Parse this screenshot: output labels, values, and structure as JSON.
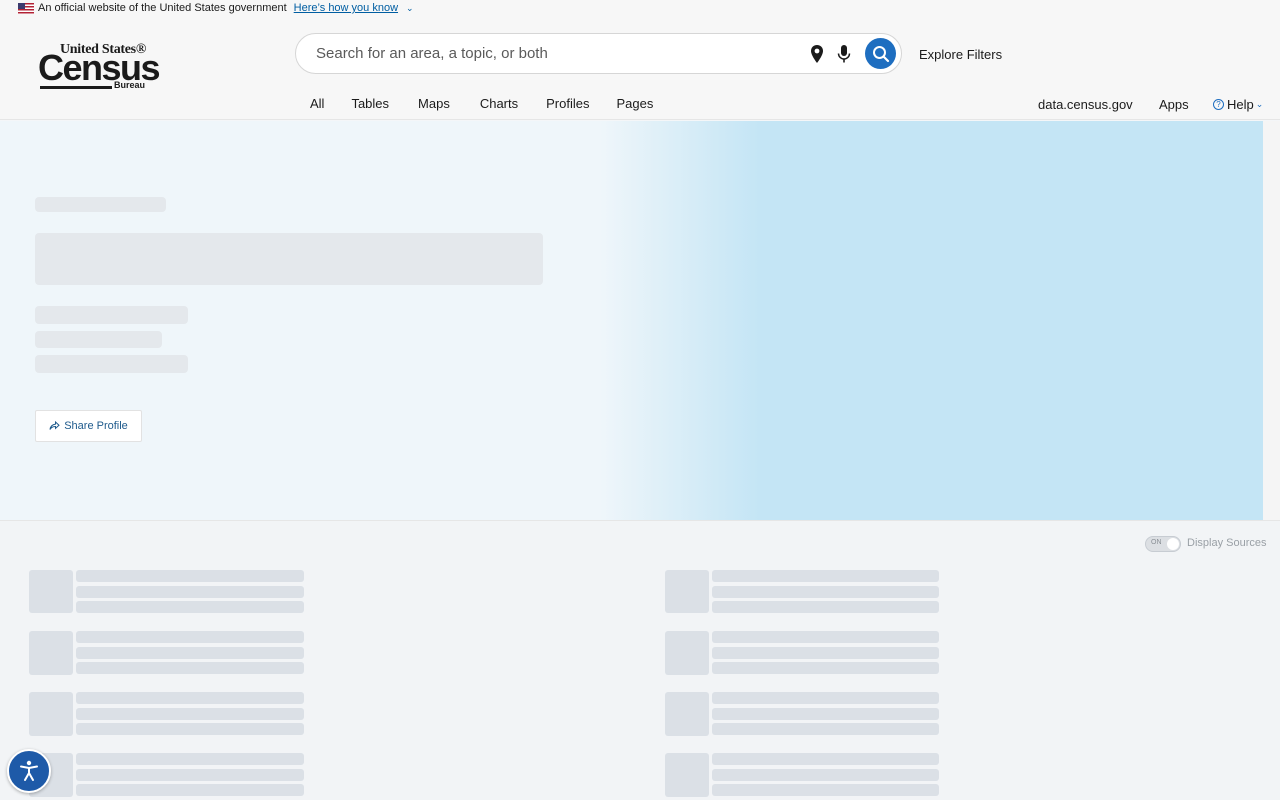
{
  "gov_banner": {
    "text": "An official website of the United States government",
    "link": "Here’s how you know"
  },
  "logo": {
    "line1": "United States®",
    "line2": "Census",
    "line3": "Bureau"
  },
  "search": {
    "placeholder": "Search for an area, a topic, or both"
  },
  "header": {
    "explore_filters": "Explore Filters",
    "nav": [
      "All",
      "Tables",
      "Maps",
      "Charts",
      "Profiles",
      "Pages"
    ],
    "right_nav": {
      "data": "data.census.gov",
      "apps": "Apps",
      "help": "Help"
    }
  },
  "hero": {
    "share_profile": "Share Profile"
  },
  "lower": {
    "toggle_state": "ON",
    "display_sources": "Display Sources"
  },
  "colors": {
    "accent": "#1e6ec0",
    "hero_left": "#eff6fa",
    "hero_right": "#c4e5f5",
    "skeleton": "#e4e8ec"
  },
  "icons": {
    "flag": "us-flag-icon",
    "pin": "location-pin-icon",
    "mic": "microphone-icon",
    "search": "search-icon",
    "share": "share-icon",
    "help": "question-circle-icon",
    "accessibility": "accessibility-icon"
  }
}
